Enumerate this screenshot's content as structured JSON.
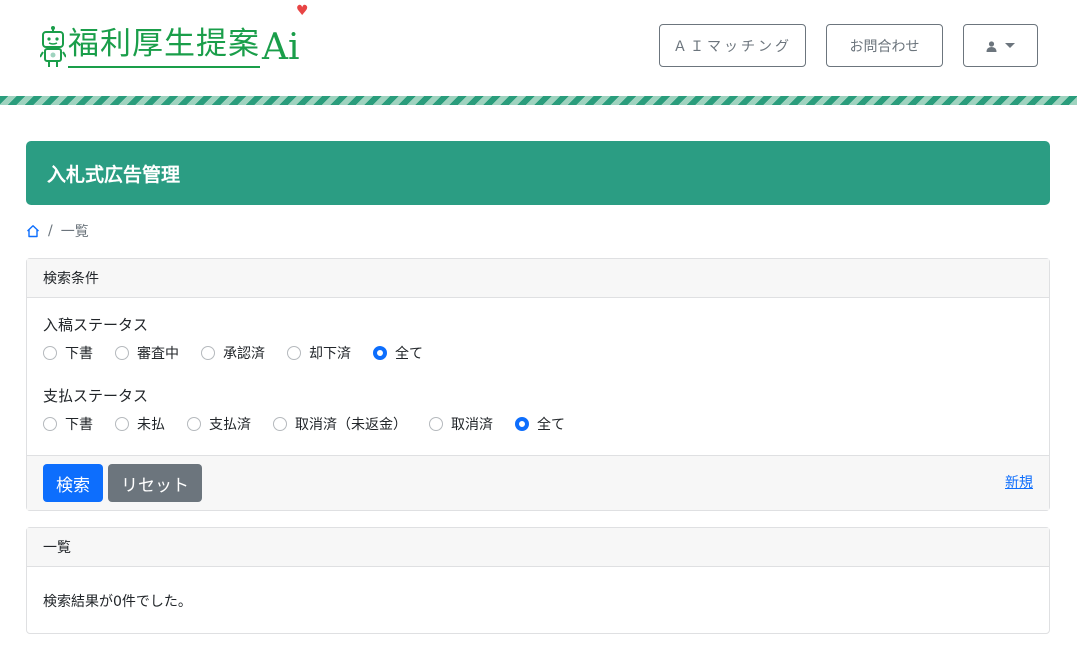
{
  "header": {
    "logo_text": "福利厚生提案",
    "logo_ai": "Ai",
    "ai_matching_button": "ＡＩマッチング",
    "contact_button": "お問合わせ"
  },
  "banner": {
    "title": "入札式広告管理"
  },
  "breadcrumb": {
    "separator": "/",
    "current": "一覧"
  },
  "search": {
    "header": "検索条件",
    "submission_status": {
      "label": "入稿ステータス",
      "options": [
        "下書",
        "審査中",
        "承認済",
        "却下済",
        "全て"
      ],
      "selected": "全て"
    },
    "payment_status": {
      "label": "支払ステータス",
      "options": [
        "下書",
        "未払",
        "支払済",
        "取消済（未返金）",
        "取消済",
        "全て"
      ],
      "selected": "全て"
    },
    "search_button": "検索",
    "reset_button": "リセット",
    "new_link": "新規"
  },
  "list": {
    "header": "一覧",
    "empty_message": "検索結果が0件でした。"
  },
  "colors": {
    "brand_green": "#1a9e4a",
    "banner": "#2b9d83",
    "primary": "#0d6efd",
    "secondary": "#6c757d",
    "heart": "#e84545"
  }
}
